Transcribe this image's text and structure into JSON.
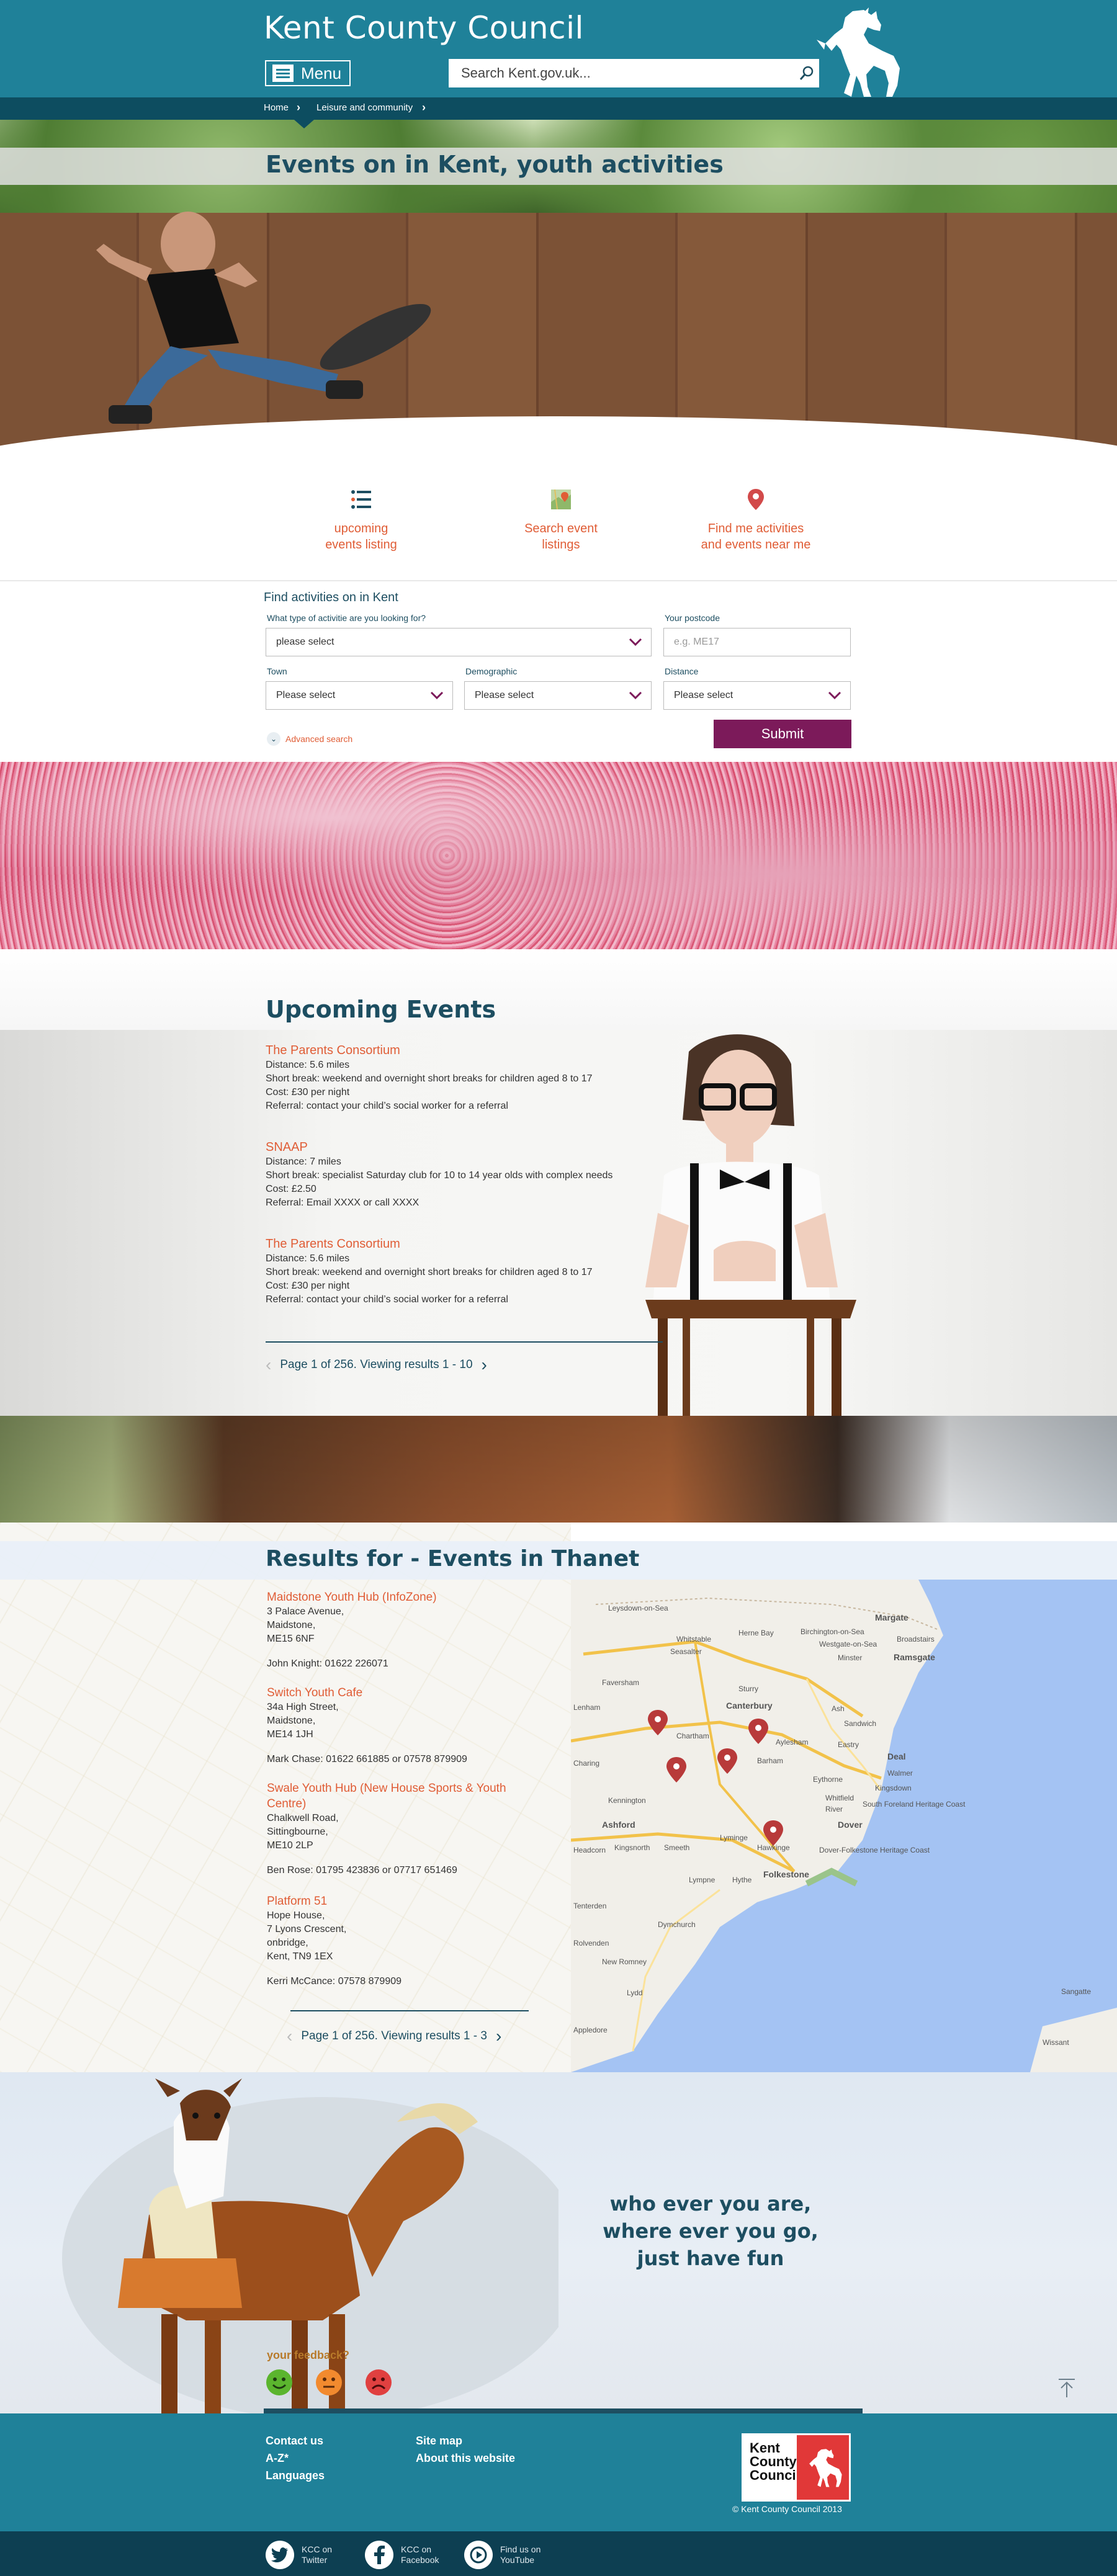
{
  "header": {
    "logo_text": "Kent County Council",
    "menu_label": "Menu",
    "search_placeholder": "Search Kent.gov.uk..."
  },
  "breadcrumb": {
    "items": [
      "Home",
      "Leisure and community"
    ]
  },
  "hero": {
    "title": "Events on in Kent, youth activities"
  },
  "quick_links": [
    {
      "label_line1": "upcoming",
      "label_line2": "events listing",
      "icon": "list-icon"
    },
    {
      "label_line1": "Search event",
      "label_line2": "listings",
      "icon": "map-icon"
    },
    {
      "label_line1": "Find me activities",
      "label_line2": "and events near me",
      "icon": "location-pin-icon"
    }
  ],
  "find_form": {
    "title": "Find activities on in Kent",
    "activity_label": "What type of activitie are you looking for?",
    "activity_value": "please select",
    "postcode_label": "Your postcode",
    "postcode_placeholder": "e.g. ME17",
    "town_label": "Town",
    "town_value": "Please select",
    "demographic_label": "Demographic",
    "demographic_value": "Please select",
    "distance_label": "Distance",
    "distance_value": "Please select",
    "advanced_search": "Advanced search",
    "submit_label": "Submit"
  },
  "upcoming": {
    "title": "Upcoming Events",
    "events": [
      {
        "title": "The Parents Consortium",
        "distance": "Distance: 5.6 miles",
        "description": "Short break: weekend and overnight short breaks for children aged 8 to 17",
        "cost": "Cost: £30 per night",
        "referral": "Referral: contact your child’s social worker for a referral"
      },
      {
        "title": "SNAAP",
        "distance": "Distance: 7 miles",
        "description": "Short break: specialist Saturday club for 10 to 14 year olds with complex needs",
        "cost": "Cost: £2.50",
        "referral": "Referral: Email XXXX or call XXXX"
      },
      {
        "title": "The Parents Consortium",
        "distance": "Distance: 5.6 miles",
        "description": "Short break: weekend and overnight short breaks for children aged 8 to 17",
        "cost": "Cost: £30 per night",
        "referral": "Referral: contact your child’s social worker for a referral"
      }
    ],
    "pager_text": "Page 1 of 256. Viewing results 1 - 10"
  },
  "results": {
    "title": "Results for - Events in Thanet",
    "items": [
      {
        "title": "Maidstone Youth Hub (InfoZone)",
        "address": [
          "3 Palace Avenue,",
          "Maidstone,",
          "ME15 6NF"
        ],
        "contact": "John Knight: 01622 226071"
      },
      {
        "title": "Switch Youth Cafe",
        "address": [
          "34a High Street,",
          "Maidstone,",
          "ME14 1JH"
        ],
        "contact": "Mark Chase: 01622 661885 or 07578 879909"
      },
      {
        "title": "Swale Youth Hub (New House Sports & Youth Centre)",
        "address": [
          "Chalkwell Road,",
          "Sittingbourne,",
          "ME10 2LP"
        ],
        "contact": "Ben Rose: 01795 423836 or 07717 651469"
      },
      {
        "title": "Platform 51",
        "address": [
          "Hope House,",
          "7 Lyons Crescent,",
          "onbridge,",
          "Kent, TN9 1EX"
        ],
        "contact": "Kerri McCance: 07578 879909"
      }
    ],
    "pager_text": "Page 1 of 256. Viewing results 1 - 3",
    "map_places": [
      "Leysdown-on-Sea",
      "Whitstable",
      "Herne Bay",
      "Birchington-on-Sea",
      "Margate",
      "Broadstairs",
      "Seasalter",
      "Westgate-on-Sea",
      "Minster",
      "Ramsgate",
      "Faversham",
      "Sturry",
      "Canterbury",
      "Chartham",
      "Ash",
      "Sandwich",
      "Eastry",
      "Barham",
      "Aylesham",
      "Deal",
      "Walmer",
      "Eythorne",
      "Kingsdown",
      "Whitfield",
      "River",
      "South Foreland Heritage Coast",
      "Dover",
      "Kennington",
      "Ashford",
      "Lyminge",
      "Hawkinge",
      "Dover-Folkestone Heritage Coast",
      "Folkestone",
      "Hythe",
      "Kingsnorth",
      "Smeeth",
      "Lympne",
      "Dymchurch",
      "New Romney",
      "Lydd",
      "Sangatte",
      "Wissant",
      "Lenham",
      "Charing",
      "Headcorn",
      "Tenterden",
      "Rolvenden",
      "Appledore"
    ]
  },
  "fun": {
    "line1": "who ever you are,",
    "line2": "where ever you go,",
    "line3": "just have fun",
    "feedback_label": "your feedback?"
  },
  "footer": {
    "col1": [
      "Contact us",
      "A-Z*",
      "Languages"
    ],
    "col2": [
      "Site map",
      "About this website"
    ],
    "logo_text": "Kent County Council",
    "copyright": "© Kent County Council 2013"
  },
  "social": [
    {
      "line1": "KCC on",
      "line2": "Twitter",
      "icon": "twitter-icon"
    },
    {
      "line1": "KCC on",
      "line2": "Facebook",
      "icon": "facebook-icon"
    },
    {
      "line1": "Find us on",
      "line2": "YouTube",
      "icon": "youtube-icon"
    }
  ],
  "colors": {
    "brand_teal": "#1f8199",
    "dark_teal": "#0d4d60",
    "heading": "#1d4e61",
    "link_orange": "#e05d36",
    "submit_purple": "#7c1a5a"
  }
}
